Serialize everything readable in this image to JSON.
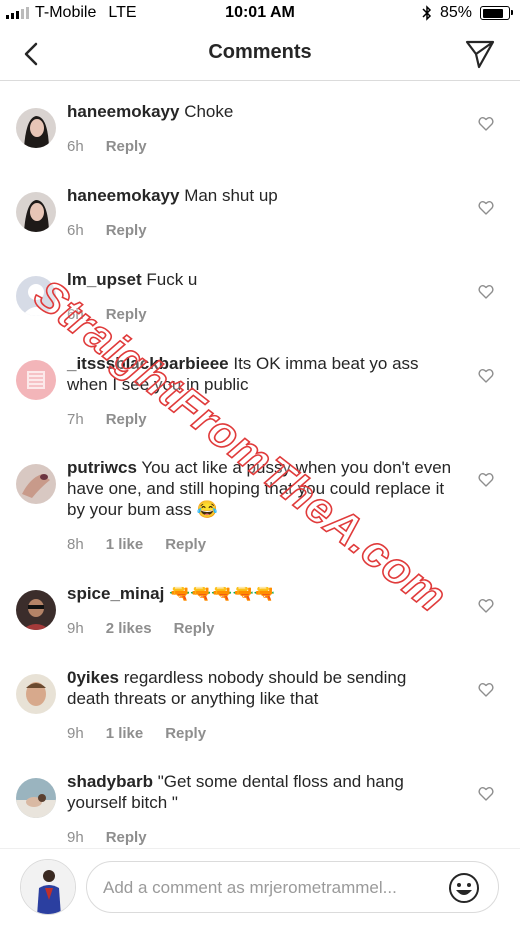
{
  "status_bar": {
    "carrier": "T-Mobile",
    "network": "LTE",
    "time": "10:01 AM",
    "battery": "85%",
    "battery_level": 0.85
  },
  "header": {
    "title": "Comments"
  },
  "comments": [
    {
      "username": "haneemokayy",
      "text": "Choke",
      "time": "6h",
      "likes": "",
      "reply": "Reply"
    },
    {
      "username": "haneemokayy",
      "text": "Man shut up",
      "time": "6h",
      "likes": "",
      "reply": "Reply"
    },
    {
      "username": "lm_upset",
      "text": "Fuck u",
      "time": "6h",
      "likes": "",
      "reply": "Reply"
    },
    {
      "username": "_itsssblackbarbieee",
      "text": "Its OK imma beat yo ass when I see you in public",
      "time": "7h",
      "likes": "",
      "reply": "Reply"
    },
    {
      "username": "putriwcs",
      "text": "You act like a pussy when you don't even have one, and still hoping that you could replace it by your bum ass 😂",
      "time": "8h",
      "likes": "1 like",
      "reply": "Reply"
    },
    {
      "username": "spice_minaj",
      "text": "🔫🔫🔫🔫🔫",
      "time": "9h",
      "likes": "2 likes",
      "reply": "Reply"
    },
    {
      "username": "0yikes",
      "text": "regardless nobody should be sending death threats or anything like that",
      "time": "9h",
      "likes": "1 like",
      "reply": "Reply"
    },
    {
      "username": "shadybarb",
      "text": "\"Get some dental floss and hang yourself bitch \"",
      "time": "9h",
      "likes": "",
      "reply": "Reply"
    }
  ],
  "input": {
    "placeholder": "Add a comment as mrjerometrammel..."
  },
  "watermark": "StraightFromTheA.com"
}
